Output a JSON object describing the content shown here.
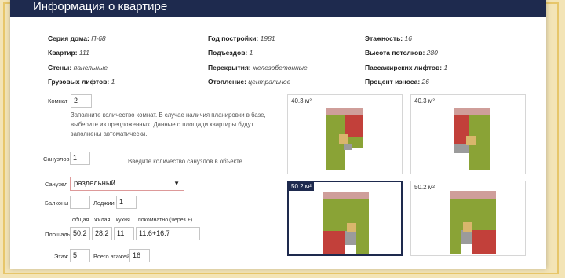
{
  "header": {
    "title": "Информация о квартире"
  },
  "info": {
    "series": {
      "label": "Серия дома:",
      "value": "П-68"
    },
    "year": {
      "label": "Год постройки:",
      "value": "1981"
    },
    "floors": {
      "label": "Этажность:",
      "value": "16"
    },
    "apartment": {
      "label": "Квартир:",
      "value": "111"
    },
    "entrances": {
      "label": "Подъездов:",
      "value": "1"
    },
    "ceiling": {
      "label": "Высота потолков:",
      "value": "280"
    },
    "walls": {
      "label": "Стены:",
      "value": "панельные"
    },
    "slabs": {
      "label": "Перекрытия:",
      "value": "железобетонные"
    },
    "passenger_lifts": {
      "label": "Пассажирских лифтов:",
      "value": "1"
    },
    "cargo_lifts": {
      "label": "Грузовых лифтов:",
      "value": "1"
    },
    "heating": {
      "label": "Отопление:",
      "value": "центральное"
    },
    "wear": {
      "label": "Процент износа:",
      "value": "26"
    }
  },
  "form": {
    "rooms": {
      "label": "Комнат",
      "value": "2"
    },
    "rooms_hint": [
      "Заполните количество комнат. В случае наличия планировки в базе,",
      "выберите из предложенных. Данные о площади квартиры будут",
      "заполнены автоматически."
    ],
    "bathrooms": {
      "label": "Санузлов",
      "value": "1"
    },
    "bathrooms_hint": "Введите количество санузлов в объекте",
    "bathroom_type": {
      "label": "Санузел",
      "value": "раздельный"
    },
    "balconies": {
      "label": "Балконы",
      "value": ""
    },
    "loggias": {
      "label": "Лоджии",
      "value": "1"
    },
    "area": {
      "label": "Площадь",
      "headers": [
        "общая",
        "жилая",
        "кухня",
        "покомнатно (через +)"
      ],
      "values": [
        "50.2",
        "28.2",
        "11",
        "11.6+16.7"
      ]
    },
    "floor": {
      "label": "Этаж",
      "value": "5"
    },
    "total_floors": {
      "label": "Всего этажей",
      "value": "16"
    }
  },
  "plans": [
    {
      "area": "40.3 м²",
      "selected": false
    },
    {
      "area": "40.3 м²",
      "selected": false
    },
    {
      "area": "50.2 м²",
      "selected": true
    },
    {
      "area": "50.2 м²",
      "selected": false
    }
  ],
  "colors": {
    "header_bg": "#1e2a4e",
    "room_green": "#8aa336",
    "room_red": "#c2403a",
    "room_pink": "#cf9e9a",
    "room_gray": "#9b9b9b",
    "room_tan": "#d9b66c"
  }
}
